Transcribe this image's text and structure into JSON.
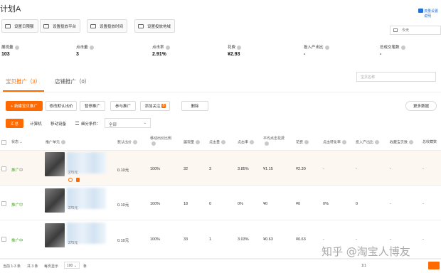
{
  "page": {
    "title": "计划A",
    "top_right_link": "流量设置说明"
  },
  "toolbar": [
    {
      "label": "设置日限额",
      "icon": "calendar-icon"
    },
    {
      "label": "设置投放平台",
      "icon": "platform-icon"
    },
    {
      "label": "设置投放时间",
      "icon": "clock-icon"
    },
    {
      "label": "设置投放地域",
      "icon": "map-icon"
    }
  ],
  "date_picker": {
    "value": "今天"
  },
  "stats": [
    {
      "label": "展现量",
      "value": "103"
    },
    {
      "label": "点击量",
      "value": "3"
    },
    {
      "label": "点击率",
      "value": "2.91%"
    },
    {
      "label": "花费",
      "value": "¥2.93"
    },
    {
      "label": "投入产出比",
      "value": "-"
    },
    {
      "label": "总成交笔数",
      "value": "-"
    }
  ],
  "tabs": [
    {
      "label": "宝贝推广（3）",
      "active": true
    },
    {
      "label": "店铺推广（0）",
      "active": false
    }
  ],
  "search": {
    "placeholder": "宝贝名称"
  },
  "actions": {
    "new": "+ 新建宝贝推广",
    "modify_bid": "修改默认出价",
    "pause": "暂停推广",
    "join": "参与推广",
    "follow": "添加关注",
    "follow_badge": "8",
    "delete": "删除",
    "more_data": "更多数据"
  },
  "filters": {
    "segments": [
      "汇总",
      "计算机",
      "移动设备"
    ],
    "condition_label": "细分条件：",
    "condition_value": "全部"
  },
  "table": {
    "headers": [
      "状态",
      "推广单元",
      "默认出价",
      "移动出价比例",
      "展现量",
      "点击量",
      "点击率",
      "平均点击花费",
      "花费",
      "点击转化率",
      "投入产出比",
      "收藏宝贝数",
      "总收藏数"
    ],
    "rows": [
      {
        "status": "推广中",
        "price_hint": "275元",
        "bid": "0.10元",
        "mobile_ratio": "100%",
        "impressions": "32",
        "clicks": "3",
        "ctr": "3.85%",
        "cpc": "¥1.15",
        "cost": "¥2.30",
        "cvr": "-",
        "roi": "-",
        "fav_items": "-",
        "fav_total": "-"
      },
      {
        "status": "推广中",
        "price_hint": "275元",
        "bid": "0.10元",
        "mobile_ratio": "100%",
        "impressions": "18",
        "clicks": "0",
        "ctr": "0%",
        "cpc": "¥0",
        "cost": "¥0",
        "cvr": "0%",
        "roi": "0",
        "fav_items": "-",
        "fav_total": "-"
      },
      {
        "status": "推广中",
        "price_hint": "275元",
        "bid": "0.10元",
        "mobile_ratio": "100%",
        "impressions": "33",
        "clicks": "1",
        "ctr": "3.03%",
        "cpc": "¥0.63",
        "cost": "¥0.63",
        "cvr": "-",
        "roi": "-",
        "fav_items": "-",
        "fav_total": "-"
      }
    ]
  },
  "footer": {
    "selected": "当前 1-3 条",
    "total": "共 3 条",
    "per_page_label": "每页显示",
    "per_page_value": "100",
    "unit": "条",
    "pager": "1/1"
  },
  "watermark": "知乎 @淘宝人博友"
}
